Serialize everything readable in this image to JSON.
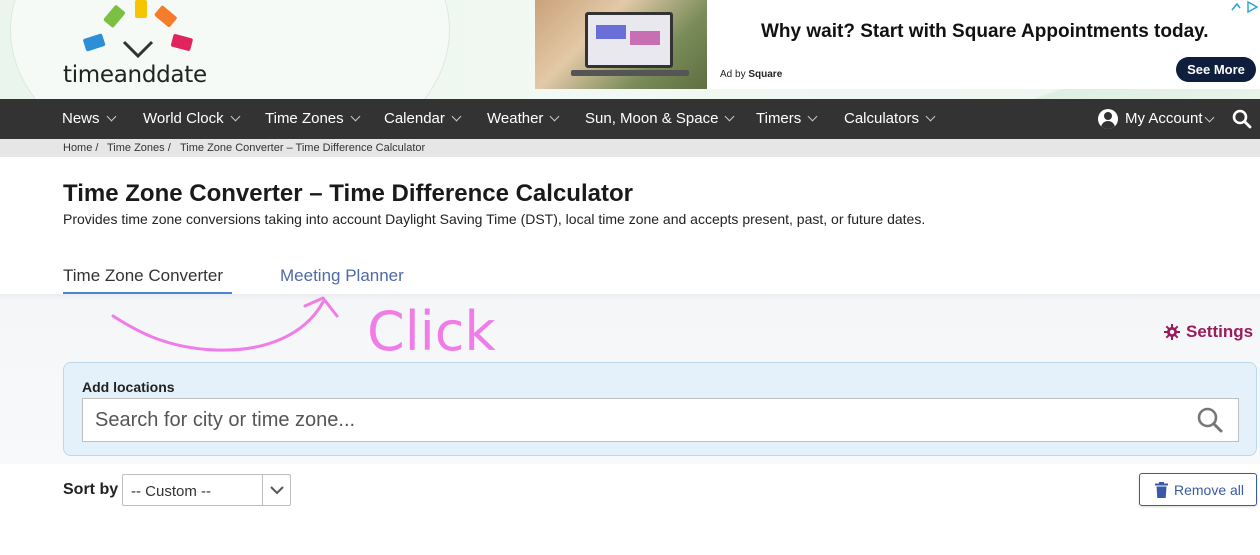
{
  "header": {
    "logo_text": "timeanddate",
    "ad": {
      "headline": "Why wait? Start with Square Appointments today.",
      "ad_by_prefix": "Ad by",
      "ad_by_brand": "Square",
      "button": "See More",
      "brand_color": "#0f1e3c"
    }
  },
  "nav": {
    "items": [
      {
        "label": "News"
      },
      {
        "label": "World Clock"
      },
      {
        "label": "Time Zones"
      },
      {
        "label": "Calendar"
      },
      {
        "label": "Weather"
      },
      {
        "label": "Sun, Moon & Space"
      },
      {
        "label": "Timers"
      },
      {
        "label": "Calculators"
      }
    ],
    "account_label": "My Account",
    "search_icon": "search-icon",
    "background": "#333333"
  },
  "breadcrumb": {
    "items": [
      "Home /",
      "Time Zones /",
      "Time Zone Converter – Time Difference Calculator"
    ]
  },
  "page": {
    "title": "Time Zone Converter – Time Difference Calculator",
    "description": "Provides time zone conversions taking into account Daylight Saving Time (DST), local time zone and accepts present, past, or future dates."
  },
  "tabs": [
    {
      "label": "Time Zone Converter",
      "active": true
    },
    {
      "label": "Meeting Planner",
      "active": false
    }
  ],
  "annotation": {
    "text": "Click",
    "color": "#f07ce8"
  },
  "settings": {
    "label": "Settings",
    "icon": "gear-icon",
    "color": "#9b1c5c"
  },
  "add_locations": {
    "label": "Add locations",
    "search_placeholder": "Search for city or time zone...",
    "search_value": ""
  },
  "sort": {
    "label": "Sort by",
    "selected": "-- Custom --"
  },
  "remove_all": {
    "label": "Remove all",
    "icon": "trash-icon",
    "color": "#3a59a8"
  }
}
